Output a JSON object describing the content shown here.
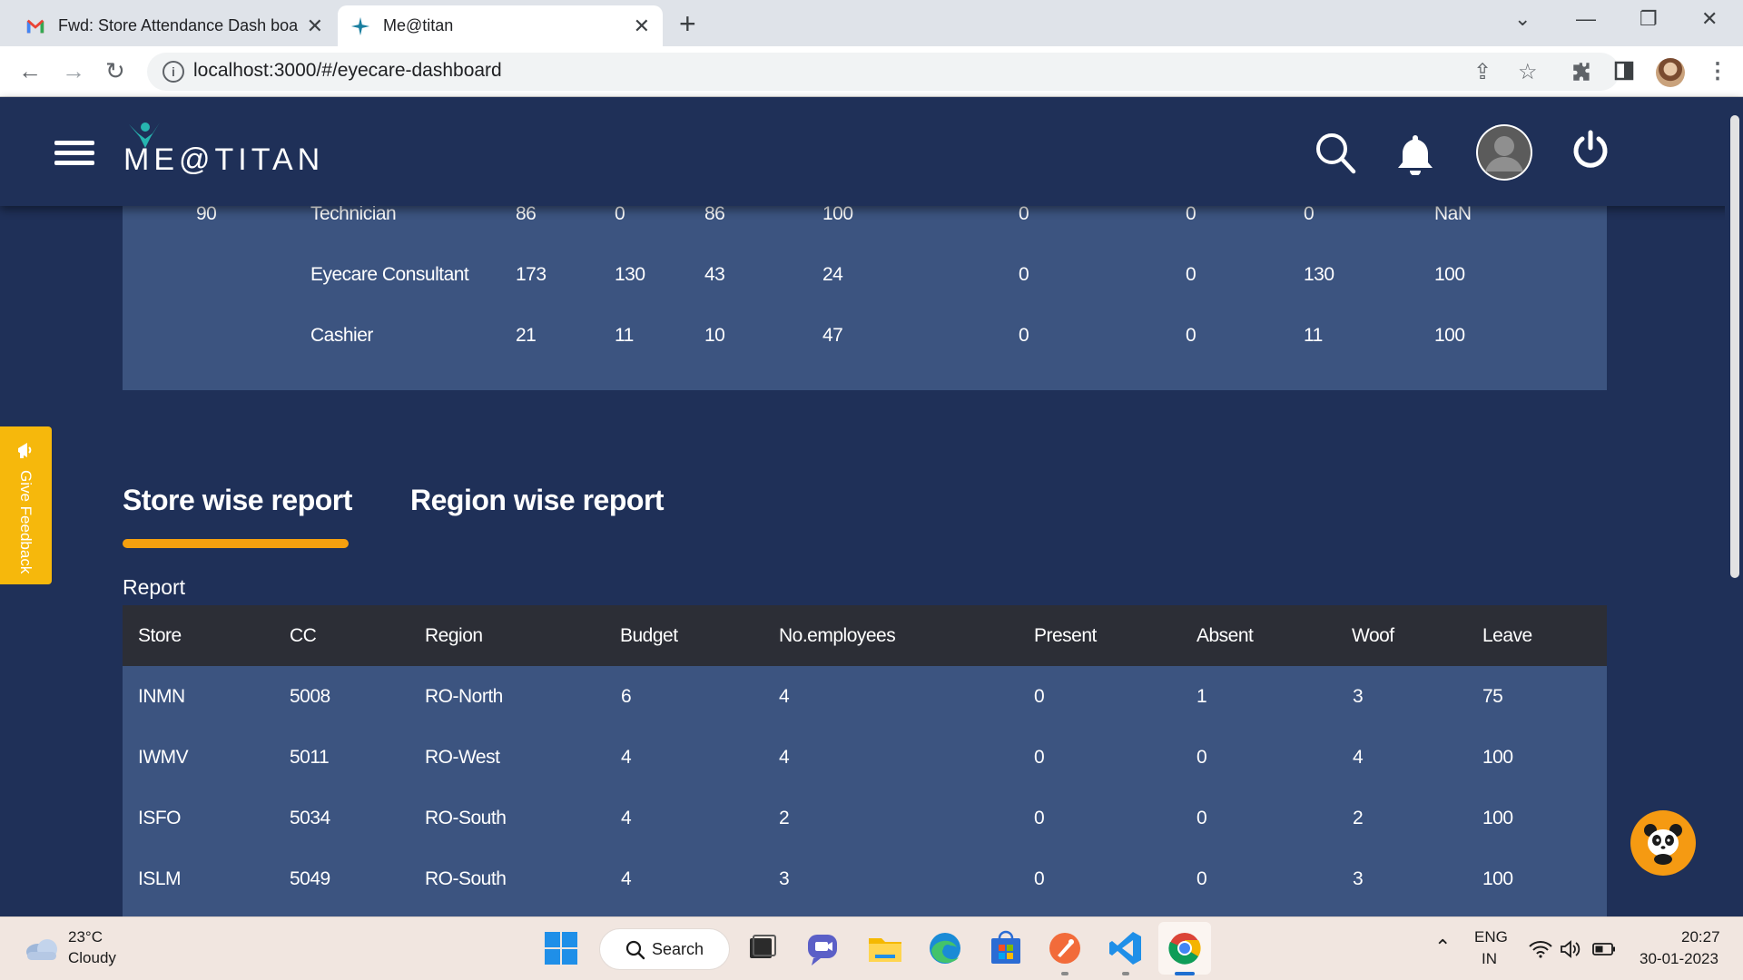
{
  "browser": {
    "tabs": [
      {
        "title": "Fwd: Store Attendance Dash board"
      },
      {
        "title": "Me@titan"
      }
    ],
    "url": "localhost:3000/#/eyecare-dashboard"
  },
  "app": {
    "logo_text": "ME@TITAN"
  },
  "role_table": {
    "rows": [
      {
        "budget": "90",
        "role": "Technician",
        "c1": "86",
        "c2": "0",
        "c3": "86",
        "c4": "100",
        "c5": "0",
        "c6": "0",
        "c7": "0",
        "c8": "NaN"
      },
      {
        "budget": "",
        "role": "Eyecare Consultant",
        "c1": "173",
        "c2": "130",
        "c3": "43",
        "c4": "24",
        "c5": "0",
        "c6": "0",
        "c7": "130",
        "c8": "100"
      },
      {
        "budget": "",
        "role": "Cashier",
        "c1": "21",
        "c2": "11",
        "c3": "10",
        "c4": "47",
        "c5": "0",
        "c6": "0",
        "c7": "11",
        "c8": "100"
      }
    ]
  },
  "report_tabs": {
    "store": "Store wise report",
    "region": "Region wise report"
  },
  "report": {
    "label": "Report",
    "columns": [
      "Store",
      "CC",
      "Region",
      "Budget",
      "No.employees",
      "Present",
      "Absent",
      "Woof",
      "Leave"
    ],
    "rows": [
      [
        "INMN",
        "5008",
        "RO-North",
        "6",
        "4",
        "0",
        "1",
        "3",
        "75"
      ],
      [
        "IWMV",
        "5011",
        "RO-West",
        "4",
        "4",
        "0",
        "0",
        "4",
        "100"
      ],
      [
        "ISFO",
        "5034",
        "RO-South",
        "4",
        "2",
        "0",
        "0",
        "2",
        "100"
      ],
      [
        "ISLM",
        "5049",
        "RO-South",
        "4",
        "3",
        "0",
        "0",
        "3",
        "100"
      ]
    ]
  },
  "feedback": {
    "label": "Give Feedback"
  },
  "taskbar": {
    "weather_temp": "23°C",
    "weather_desc": "Cloudy",
    "search_label": "Search",
    "lang_top": "ENG",
    "lang_bottom": "IN",
    "time": "20:27",
    "date": "30-01-2023"
  }
}
